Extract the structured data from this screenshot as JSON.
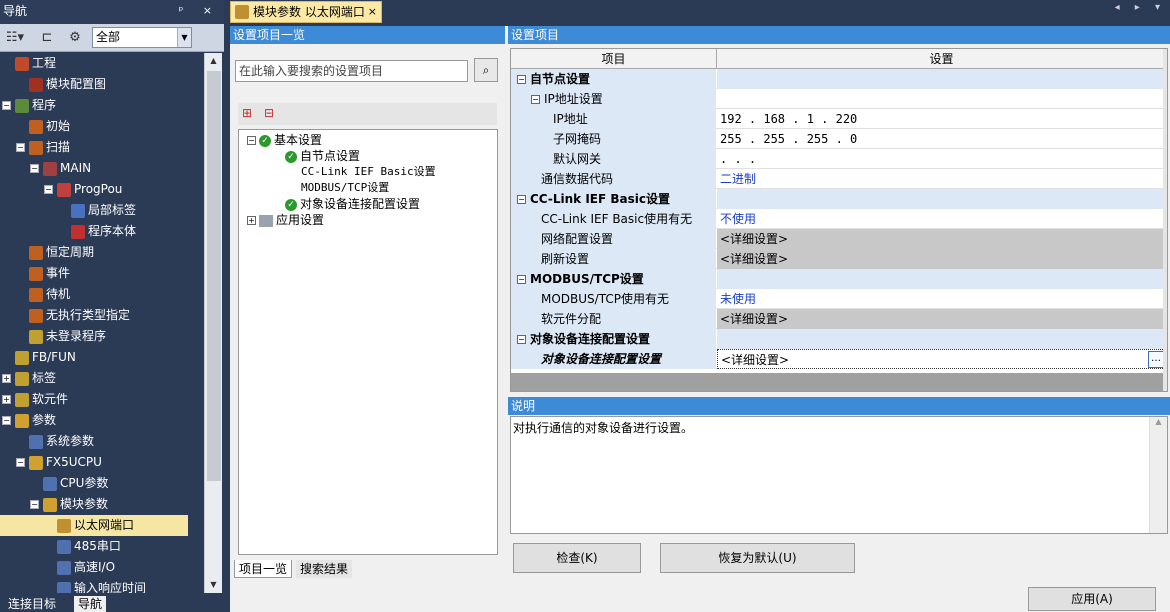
{
  "nav": {
    "title": "导航",
    "title_buttons": "ᵖ ×",
    "filter_value": "全部",
    "items": [
      {
        "label": "工程",
        "level": 0,
        "exp": "",
        "color": "#c04a2a"
      },
      {
        "label": "模块配置图",
        "level": 1,
        "exp": "",
        "color": "#a03020"
      },
      {
        "label": "程序",
        "level": 0,
        "exp": "−",
        "color": "#5a8a3a"
      },
      {
        "label": "初始",
        "level": 1,
        "exp": "",
        "color": "#c06020"
      },
      {
        "label": "扫描",
        "level": 1,
        "exp": "−",
        "color": "#c06020"
      },
      {
        "label": "MAIN",
        "level": 2,
        "exp": "−",
        "color": "#a04040"
      },
      {
        "label": "ProgPou",
        "level": 3,
        "exp": "−",
        "color": "#c04040"
      },
      {
        "label": "局部标签",
        "level": 4,
        "exp": "",
        "color": "#4a70c0"
      },
      {
        "label": "程序本体",
        "level": 4,
        "exp": "",
        "color": "#c03030"
      },
      {
        "label": "恒定周期",
        "level": 1,
        "exp": "",
        "color": "#c06020"
      },
      {
        "label": "事件",
        "level": 1,
        "exp": "",
        "color": "#c06020"
      },
      {
        "label": "待机",
        "level": 1,
        "exp": "",
        "color": "#c06020"
      },
      {
        "label": "无执行类型指定",
        "level": 1,
        "exp": "",
        "color": "#c06020"
      },
      {
        "label": "未登录程序",
        "level": 1,
        "exp": "",
        "color": "#c0a030"
      },
      {
        "label": "FB/FUN",
        "level": 0,
        "exp": "",
        "color": "#c0a030"
      },
      {
        "label": "标签",
        "level": 0,
        "exp": "+",
        "color": "#c0a030"
      },
      {
        "label": "软元件",
        "level": 0,
        "exp": "+",
        "color": "#c0a030"
      },
      {
        "label": "参数",
        "level": 0,
        "exp": "−",
        "color": "#d0a030"
      },
      {
        "label": "系统参数",
        "level": 1,
        "exp": "",
        "color": "#5070b0"
      },
      {
        "label": "FX5UCPU",
        "level": 1,
        "exp": "−",
        "color": "#d0a030"
      },
      {
        "label": "CPU参数",
        "level": 2,
        "exp": "",
        "color": "#5070b0"
      },
      {
        "label": "模块参数",
        "level": 2,
        "exp": "−",
        "color": "#d0a030"
      },
      {
        "label": "以太网端口",
        "level": 3,
        "exp": "",
        "color": "#c09030",
        "selected": true
      },
      {
        "label": "485串口",
        "level": 3,
        "exp": "",
        "color": "#5070b0"
      },
      {
        "label": "高速I/O",
        "level": 3,
        "exp": "",
        "color": "#5070b0"
      },
      {
        "label": "输入响应时间",
        "level": 3,
        "exp": "",
        "color": "#5070b0"
      }
    ],
    "bottom_tabs": [
      "连接目标",
      "导航"
    ]
  },
  "doc_tab": {
    "label": "模块参数 以太网端口",
    "close": "×"
  },
  "doc_arrows": "◂ ▸ ▾",
  "left": {
    "header": "设置项目一览",
    "search_placeholder": "在此输入要搜索的设置项目",
    "binoculars_icon": "binoculars-icon",
    "tree": {
      "root": "基本设置",
      "children": [
        "自节点设置",
        "CC-Link IEF Basic设置",
        "MODBUS/TCP设置",
        "对象设备连接配置设置"
      ],
      "app": "应用设置"
    },
    "tabs": [
      "项目一览",
      "搜索结果"
    ]
  },
  "right": {
    "header": "设置项目",
    "col_item": "项目",
    "col_setting": "设置",
    "rows": [
      {
        "item": "自节点设置",
        "value": "",
        "type": "cat"
      },
      {
        "item": "IP地址设置",
        "value": "",
        "type": "sub"
      },
      {
        "item": "IP地址",
        "value": "192 . 168 .   1 . 220",
        "type": "leaf"
      },
      {
        "item": "子网掩码",
        "value": "255 . 255 . 255 .   0",
        "type": "leaf"
      },
      {
        "item": "默认网关",
        "value": "   .    .    .",
        "type": "leaf"
      },
      {
        "item": "通信数据代码",
        "value": "二进制",
        "type": "leaf1",
        "style": "link"
      },
      {
        "item": "CC-Link IEF Basic设置",
        "value": "",
        "type": "cat"
      },
      {
        "item": "CC-Link IEF Basic使用有无",
        "value": "不使用",
        "type": "leaf1",
        "style": "link"
      },
      {
        "item": "网络配置设置",
        "value": "<详细设置>",
        "type": "leaf1",
        "style": "gray"
      },
      {
        "item": "刷新设置",
        "value": "<详细设置>",
        "type": "leaf1",
        "style": "gray"
      },
      {
        "item": "MODBUS/TCP设置",
        "value": "",
        "type": "cat"
      },
      {
        "item": "MODBUS/TCP使用有无",
        "value": "未使用",
        "type": "leaf1",
        "style": "link"
      },
      {
        "item": "软元件分配",
        "value": "<详细设置>",
        "type": "leaf1",
        "style": "gray"
      },
      {
        "item": "对象设备连接配置设置",
        "value": "",
        "type": "cat"
      },
      {
        "item": "对象设备连接配置设置",
        "value": "<详细设置>",
        "type": "leaf1",
        "style": "edit"
      }
    ],
    "desc_header": "说明",
    "desc_text": "对执行通信的对象设备进行设置。"
  },
  "buttons": {
    "check": "检查(K)",
    "restore": "恢复为默认(U)",
    "apply": "应用(A)"
  }
}
